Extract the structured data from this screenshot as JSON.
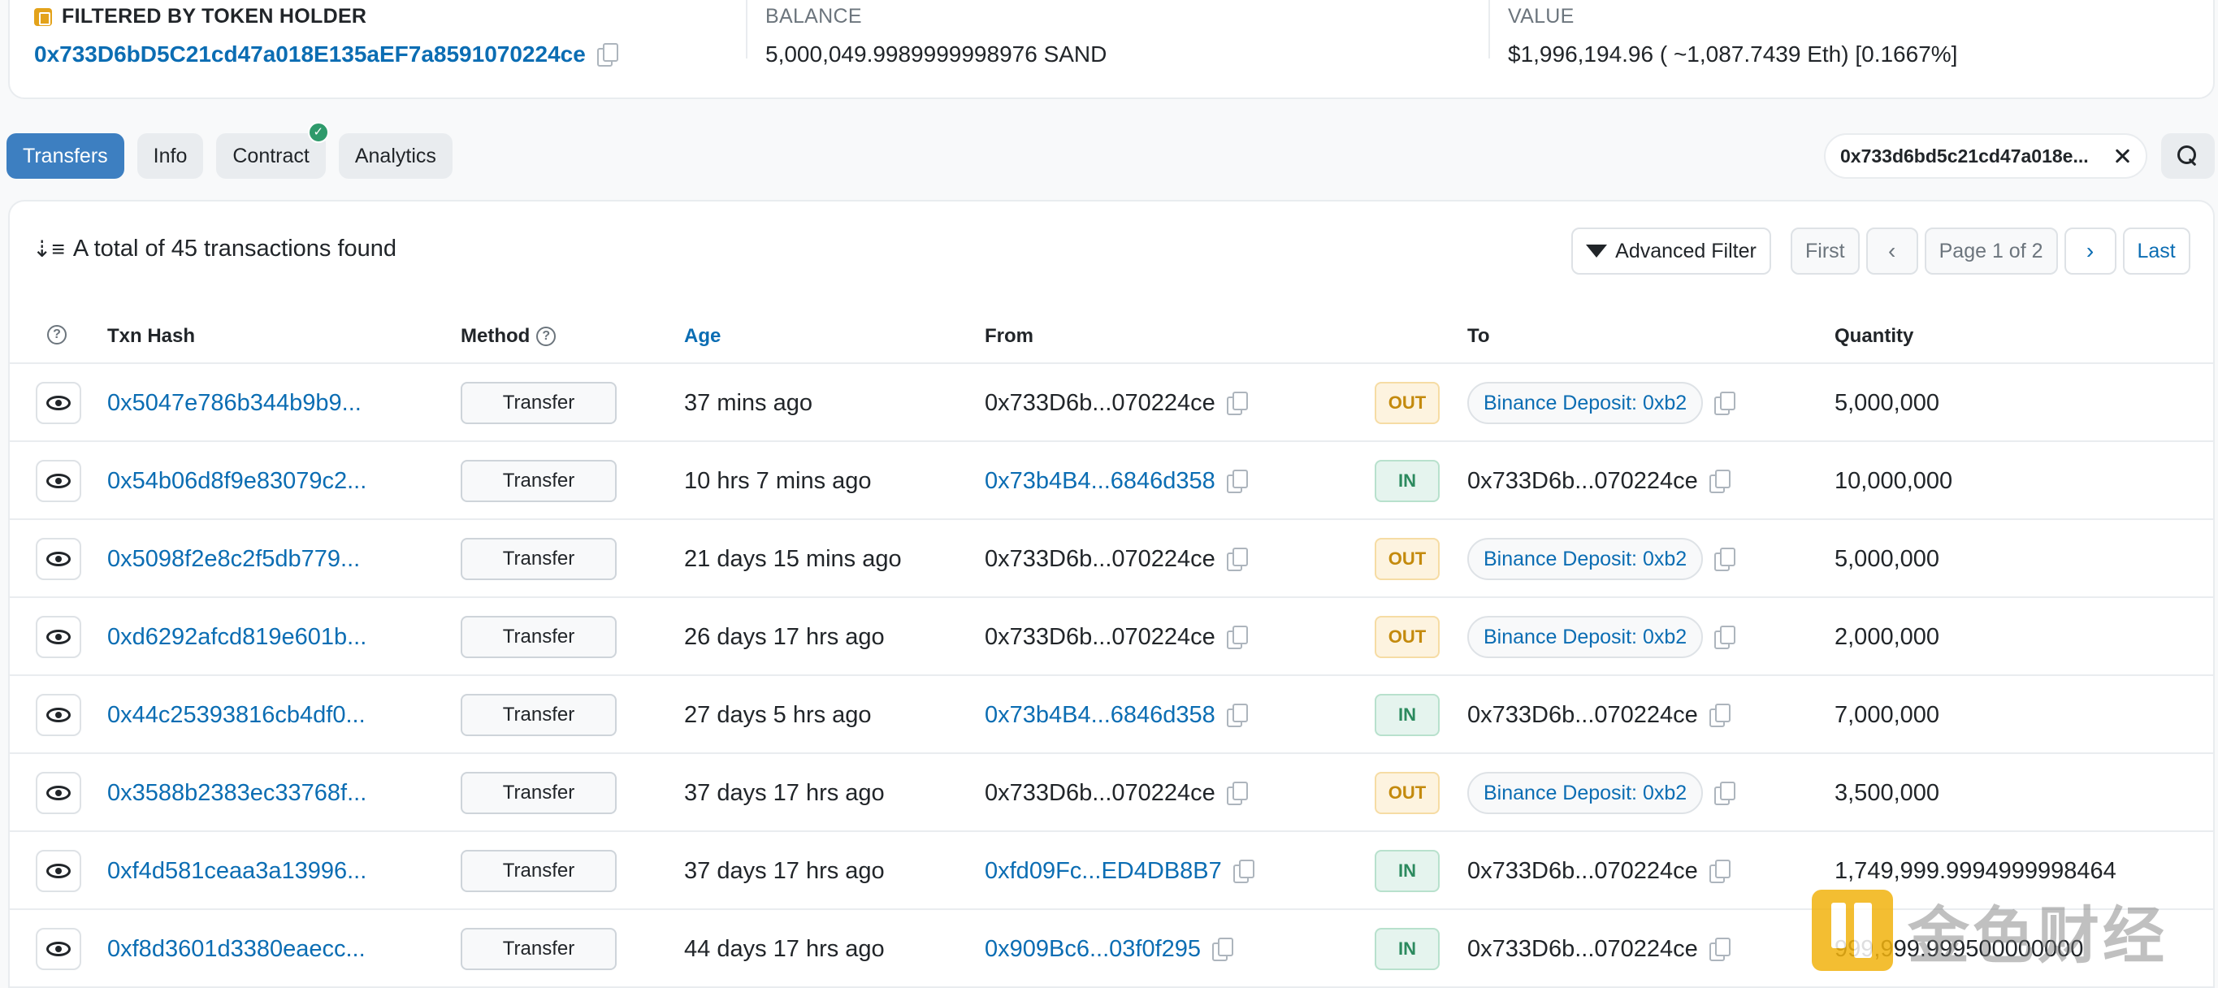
{
  "summary": {
    "holder_label": "FILTERED BY TOKEN HOLDER",
    "holder_address": "0x733D6bD5C21cd47a018E135aEF7a8591070224ce",
    "balance_label": "BALANCE",
    "balance_value": "5,000,049.9989999998976 SAND",
    "value_label": "VALUE",
    "value_value": "$1,996,194.96 ( ~1,087.7439 Eth) [0.1667%]"
  },
  "tabs": [
    {
      "label": "Transfers",
      "active": true
    },
    {
      "label": "Info",
      "active": false
    },
    {
      "label": "Contract",
      "active": false,
      "verified": true
    },
    {
      "label": "Analytics",
      "active": false
    }
  ],
  "filter_chip": "0x733d6bd5c21cd47a018e...",
  "toolbar": {
    "total_text": "A total of 45 transactions found",
    "advanced_filter": "Advanced Filter",
    "first": "First",
    "page_text": "Page 1 of 2",
    "last": "Last"
  },
  "columns": {
    "txn_hash": "Txn Hash",
    "method": "Method",
    "age": "Age",
    "from": "From",
    "to": "To",
    "quantity": "Quantity"
  },
  "rows": [
    {
      "hash": "0x5047e786b344b9b9...",
      "method": "Transfer",
      "age": "37 mins ago",
      "from": "0x733D6b...070224ce",
      "from_link": false,
      "dir": "OUT",
      "to": "Binance Deposit: 0xb2",
      "to_tag": true,
      "qty": "5,000,000"
    },
    {
      "hash": "0x54b06d8f9e83079c2...",
      "method": "Transfer",
      "age": "10 hrs 7 mins ago",
      "from": "0x73b4B4...6846d358",
      "from_link": true,
      "dir": "IN",
      "to": "0x733D6b...070224ce",
      "to_tag": false,
      "qty": "10,000,000"
    },
    {
      "hash": "0x5098f2e8c2f5db779...",
      "method": "Transfer",
      "age": "21 days 15 mins ago",
      "from": "0x733D6b...070224ce",
      "from_link": false,
      "dir": "OUT",
      "to": "Binance Deposit: 0xb2",
      "to_tag": true,
      "qty": "5,000,000"
    },
    {
      "hash": "0xd6292afcd819e601b...",
      "method": "Transfer",
      "age": "26 days 17 hrs ago",
      "from": "0x733D6b...070224ce",
      "from_link": false,
      "dir": "OUT",
      "to": "Binance Deposit: 0xb2",
      "to_tag": true,
      "qty": "2,000,000"
    },
    {
      "hash": "0x44c25393816cb4df0...",
      "method": "Transfer",
      "age": "27 days 5 hrs ago",
      "from": "0x73b4B4...6846d358",
      "from_link": true,
      "dir": "IN",
      "to": "0x733D6b...070224ce",
      "to_tag": false,
      "qty": "7,000,000"
    },
    {
      "hash": "0x3588b2383ec33768f...",
      "method": "Transfer",
      "age": "37 days 17 hrs ago",
      "from": "0x733D6b...070224ce",
      "from_link": false,
      "dir": "OUT",
      "to": "Binance Deposit: 0xb2",
      "to_tag": true,
      "qty": "3,500,000"
    },
    {
      "hash": "0xf4d581ceaa3a13996...",
      "method": "Transfer",
      "age": "37 days 17 hrs ago",
      "from": "0xfd09Fc...ED4DB8B7",
      "from_link": true,
      "dir": "IN",
      "to": "0x733D6b...070224ce",
      "to_tag": false,
      "qty": "1,749,999.9994999998464"
    },
    {
      "hash": "0xf8d3601d3380eaecc...",
      "method": "Transfer",
      "age": "44 days 17 hrs ago",
      "from": "0x909Bc6...03f0f295",
      "from_link": true,
      "dir": "IN",
      "to": "0x733D6b...070224ce",
      "to_tag": false,
      "qty": "999,999.999500000000"
    }
  ],
  "watermark": "金色财经",
  "colors": {
    "accent": "#0b6db3",
    "tab_active": "#3d7fc1",
    "out": "#c48a0d",
    "in": "#2b8a5e"
  }
}
